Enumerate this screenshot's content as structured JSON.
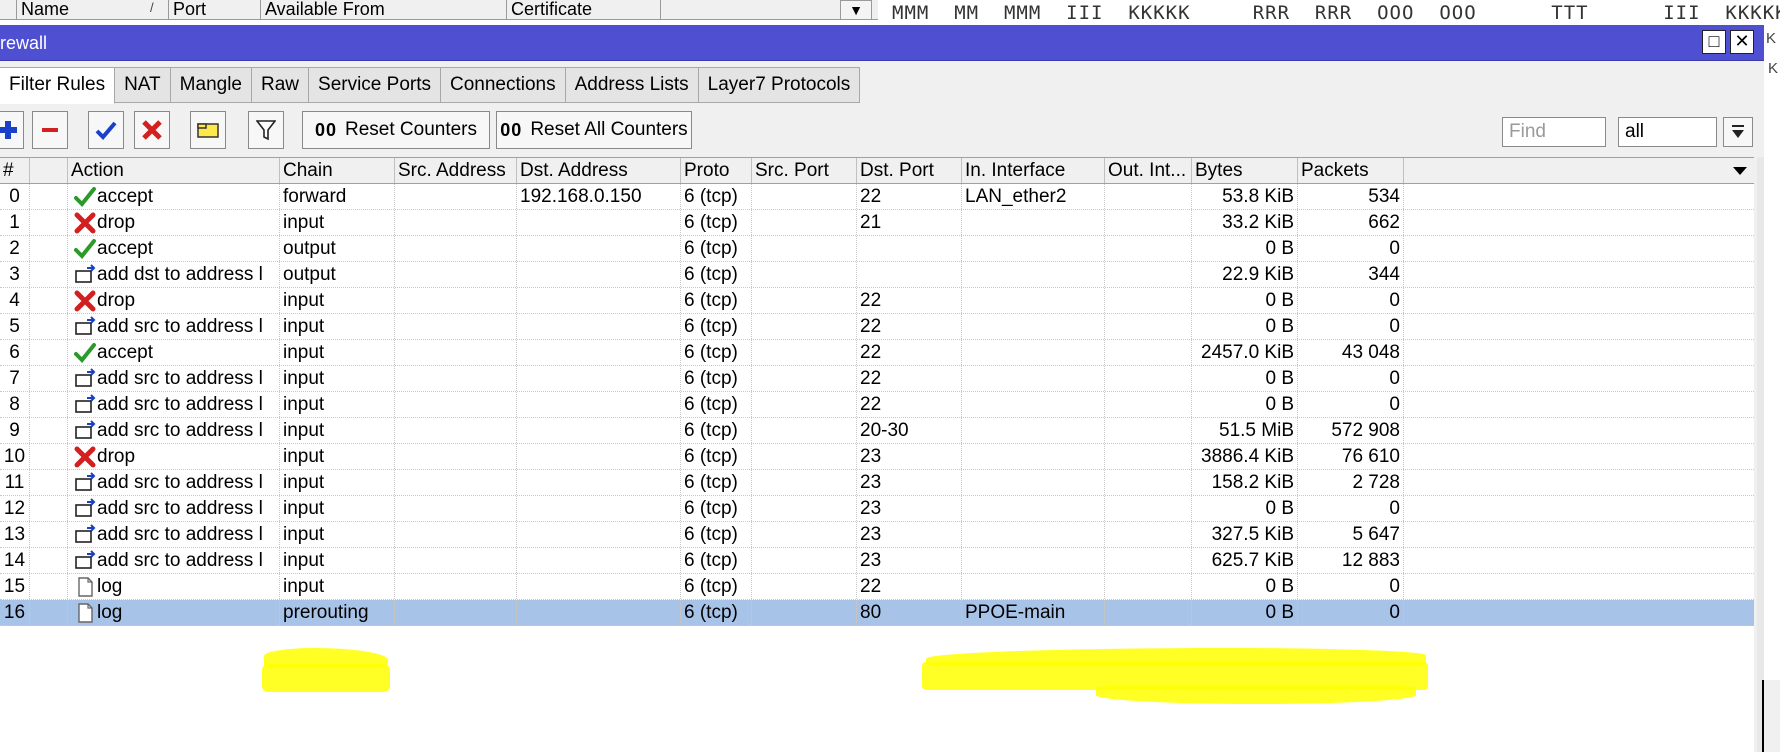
{
  "background_window": {
    "columns": [
      "Name",
      "Port",
      "Available From",
      "Certificate"
    ],
    "sort_indicator": "/",
    "mono_text": "MMM  MM  MMM  III  KKKKK     RRR  RRR  OOO  OOO      TTT      III  KKKKK"
  },
  "window": {
    "title": "rewall",
    "maximize_icon": "□",
    "close_icon": "✕"
  },
  "tabs": [
    {
      "label": "Filter Rules",
      "active": true
    },
    {
      "label": "NAT"
    },
    {
      "label": "Mangle"
    },
    {
      "label": "Raw"
    },
    {
      "label": "Service Ports"
    },
    {
      "label": "Connections"
    },
    {
      "label": "Address Lists"
    },
    {
      "label": "Layer7 Protocols"
    }
  ],
  "toolbar": {
    "reset_counters_prefix": "00",
    "reset_counters_label": "Reset Counters",
    "reset_all_counters_prefix": "00",
    "reset_all_counters_label": "Reset All Counters",
    "find_placeholder": "Find",
    "filter_value": "all"
  },
  "table": {
    "columns": [
      "#",
      "",
      "Action",
      "Chain",
      "Src. Address",
      "Dst. Address",
      "Proto",
      "Src. Port",
      "Dst. Port",
      "In. Interface",
      "Out. Int...",
      "Bytes",
      "Packets"
    ],
    "rows": [
      {
        "n": "0",
        "icon": "accept",
        "action": "accept",
        "chain": "forward",
        "src": "",
        "dst": "192.168.0.150",
        "proto": "6 (tcp)",
        "sport": "",
        "dport": "22",
        "inif": "LAN_ether2",
        "outif": "",
        "bytes": "53.8 KiB",
        "packets": "534"
      },
      {
        "n": "1",
        "icon": "drop",
        "action": "drop",
        "chain": "input",
        "src": "",
        "dst": "",
        "proto": "6 (tcp)",
        "sport": "",
        "dport": "21",
        "inif": "",
        "outif": "",
        "bytes": "33.2 KiB",
        "packets": "662"
      },
      {
        "n": "2",
        "icon": "accept",
        "action": "accept",
        "chain": "output",
        "src": "",
        "dst": "",
        "proto": "6 (tcp)",
        "sport": "",
        "dport": "",
        "inif": "",
        "outif": "",
        "bytes": "0 B",
        "packets": "0"
      },
      {
        "n": "3",
        "icon": "addlist",
        "action": "add dst to address l",
        "chain": "output",
        "src": "",
        "dst": "",
        "proto": "6 (tcp)",
        "sport": "",
        "dport": "",
        "inif": "",
        "outif": "",
        "bytes": "22.9 KiB",
        "packets": "344"
      },
      {
        "n": "4",
        "icon": "drop",
        "action": "drop",
        "chain": "input",
        "src": "",
        "dst": "",
        "proto": "6 (tcp)",
        "sport": "",
        "dport": "22",
        "inif": "",
        "outif": "",
        "bytes": "0 B",
        "packets": "0"
      },
      {
        "n": "5",
        "icon": "addlist",
        "action": "add src to address l",
        "chain": "input",
        "src": "",
        "dst": "",
        "proto": "6 (tcp)",
        "sport": "",
        "dport": "22",
        "inif": "",
        "outif": "",
        "bytes": "0 B",
        "packets": "0"
      },
      {
        "n": "6",
        "icon": "accept",
        "action": "accept",
        "chain": "input",
        "src": "",
        "dst": "",
        "proto": "6 (tcp)",
        "sport": "",
        "dport": "22",
        "inif": "",
        "outif": "",
        "bytes": "2457.0 KiB",
        "packets": "43 048"
      },
      {
        "n": "7",
        "icon": "addlist",
        "action": "add src to address l",
        "chain": "input",
        "src": "",
        "dst": "",
        "proto": "6 (tcp)",
        "sport": "",
        "dport": "22",
        "inif": "",
        "outif": "",
        "bytes": "0 B",
        "packets": "0"
      },
      {
        "n": "8",
        "icon": "addlist",
        "action": "add src to address l",
        "chain": "input",
        "src": "",
        "dst": "",
        "proto": "6 (tcp)",
        "sport": "",
        "dport": "22",
        "inif": "",
        "outif": "",
        "bytes": "0 B",
        "packets": "0"
      },
      {
        "n": "9",
        "icon": "addlist",
        "action": "add src to address l",
        "chain": "input",
        "src": "",
        "dst": "",
        "proto": "6 (tcp)",
        "sport": "",
        "dport": "20-30",
        "inif": "",
        "outif": "",
        "bytes": "51.5 MiB",
        "packets": "572 908"
      },
      {
        "n": "10",
        "icon": "drop",
        "action": "drop",
        "chain": "input",
        "src": "",
        "dst": "",
        "proto": "6 (tcp)",
        "sport": "",
        "dport": "23",
        "inif": "",
        "outif": "",
        "bytes": "3886.4 KiB",
        "packets": "76 610"
      },
      {
        "n": "11",
        "icon": "addlist",
        "action": "add src to address l",
        "chain": "input",
        "src": "",
        "dst": "",
        "proto": "6 (tcp)",
        "sport": "",
        "dport": "23",
        "inif": "",
        "outif": "",
        "bytes": "158.2 KiB",
        "packets": "2 728"
      },
      {
        "n": "12",
        "icon": "addlist",
        "action": "add src to address l",
        "chain": "input",
        "src": "",
        "dst": "",
        "proto": "6 (tcp)",
        "sport": "",
        "dport": "23",
        "inif": "",
        "outif": "",
        "bytes": "0 B",
        "packets": "0"
      },
      {
        "n": "13",
        "icon": "addlist",
        "action": "add src to address l",
        "chain": "input",
        "src": "",
        "dst": "",
        "proto": "6 (tcp)",
        "sport": "",
        "dport": "23",
        "inif": "",
        "outif": "",
        "bytes": "327.5 KiB",
        "packets": "5 647"
      },
      {
        "n": "14",
        "icon": "addlist",
        "action": "add src to address l",
        "chain": "input",
        "src": "",
        "dst": "",
        "proto": "6 (tcp)",
        "sport": "",
        "dport": "23",
        "inif": "",
        "outif": "",
        "bytes": "625.7 KiB",
        "packets": "12 883"
      },
      {
        "n": "15",
        "icon": "log",
        "action": "log",
        "chain": "input",
        "src": "",
        "dst": "",
        "proto": "6 (tcp)",
        "sport": "",
        "dport": "22",
        "inif": "",
        "outif": "",
        "bytes": "0 B",
        "packets": "0"
      },
      {
        "n": "16",
        "icon": "log",
        "action": "log",
        "chain": "prerouting",
        "src": "",
        "dst": "",
        "proto": "6 (tcp)",
        "sport": "",
        "dport": "80",
        "inif": "PPOE-main",
        "outif": "",
        "bytes": "0 B",
        "packets": "0",
        "selected": true
      }
    ]
  },
  "colors": {
    "titlebar": "#4f4fd1",
    "selected_row": "#a7c3e8",
    "highlighter": "#ffff00",
    "accept_icon": "#2a9a2a",
    "drop_icon": "#d22020",
    "add_icon": "#1a3fc8"
  }
}
